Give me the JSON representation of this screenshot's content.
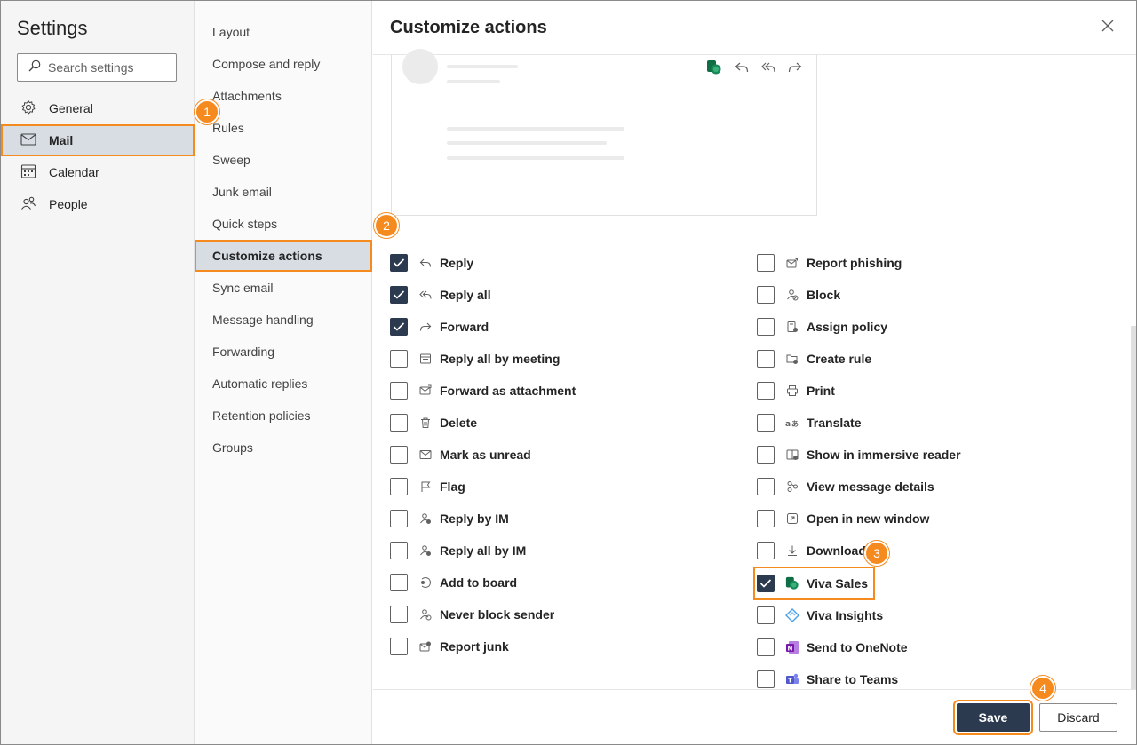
{
  "sidebar": {
    "title": "Settings",
    "search_placeholder": "Search settings",
    "items": [
      {
        "label": "General",
        "icon": "gear-icon"
      },
      {
        "label": "Mail",
        "icon": "mail-icon",
        "selected": true
      },
      {
        "label": "Calendar",
        "icon": "calendar-icon"
      },
      {
        "label": "People",
        "icon": "people-icon"
      }
    ]
  },
  "submenu": {
    "items": [
      {
        "label": "Layout"
      },
      {
        "label": "Compose and reply"
      },
      {
        "label": "Attachments"
      },
      {
        "label": "Rules"
      },
      {
        "label": "Sweep"
      },
      {
        "label": "Junk email"
      },
      {
        "label": "Quick steps"
      },
      {
        "label": "Customize actions",
        "selected": true
      },
      {
        "label": "Sync email"
      },
      {
        "label": "Message handling"
      },
      {
        "label": "Forwarding"
      },
      {
        "label": "Automatic replies"
      },
      {
        "label": "Retention policies"
      },
      {
        "label": "Groups"
      }
    ]
  },
  "main": {
    "title": "Customize actions",
    "left_actions": [
      {
        "label": "Reply",
        "checked": true,
        "icon": "reply-icon"
      },
      {
        "label": "Reply all",
        "checked": true,
        "icon": "reply-all-icon"
      },
      {
        "label": "Forward",
        "checked": true,
        "icon": "forward-icon"
      },
      {
        "label": "Reply all by meeting",
        "checked": false,
        "icon": "meeting-icon"
      },
      {
        "label": "Forward as attachment",
        "checked": false,
        "icon": "mail-attachment-icon"
      },
      {
        "label": "Delete",
        "checked": false,
        "icon": "trash-icon"
      },
      {
        "label": "Mark as unread",
        "checked": false,
        "icon": "envelope-icon"
      },
      {
        "label": "Flag",
        "checked": false,
        "icon": "flag-icon"
      },
      {
        "label": "Reply by IM",
        "checked": false,
        "icon": "person-chat-icon"
      },
      {
        "label": "Reply all by IM",
        "checked": false,
        "icon": "people-chat-icon"
      },
      {
        "label": "Add to board",
        "checked": false,
        "icon": "board-icon"
      },
      {
        "label": "Never block sender",
        "checked": false,
        "icon": "person-check-icon"
      },
      {
        "label": "Report junk",
        "checked": false,
        "icon": "junk-icon"
      }
    ],
    "right_actions": [
      {
        "label": "Report phishing",
        "checked": false,
        "icon": "phishing-icon"
      },
      {
        "label": "Block",
        "checked": false,
        "icon": "block-icon"
      },
      {
        "label": "Assign policy",
        "checked": false,
        "icon": "policy-icon"
      },
      {
        "label": "Create rule",
        "checked": false,
        "icon": "rule-icon"
      },
      {
        "label": "Print",
        "checked": false,
        "icon": "print-icon"
      },
      {
        "label": "Translate",
        "checked": false,
        "icon": "translate-icon"
      },
      {
        "label": "Show in immersive reader",
        "checked": false,
        "icon": "immersive-reader-icon"
      },
      {
        "label": "View message details",
        "checked": false,
        "icon": "details-icon"
      },
      {
        "label": "Open in new window",
        "checked": false,
        "icon": "new-window-icon"
      },
      {
        "label": "Download",
        "checked": false,
        "icon": "download-icon"
      },
      {
        "label": "Viva Sales",
        "checked": true,
        "icon": "viva-sales-icon",
        "highlighted": true
      },
      {
        "label": "Viva Insights",
        "checked": false,
        "icon": "viva-insights-icon"
      },
      {
        "label": "Send to OneNote",
        "checked": false,
        "icon": "onenote-icon"
      },
      {
        "label": "Share to Teams",
        "checked": false,
        "icon": "teams-icon"
      }
    ],
    "save_label": "Save",
    "discard_label": "Discard"
  },
  "badges": [
    "1",
    "2",
    "3",
    "4"
  ],
  "colors": {
    "accent": "#f58a1f",
    "checkbox_checked": "#2b3a4e",
    "selected_bg": "#d8dde4",
    "viva_sales": "#1a8a5a",
    "onenote": "#7719aa",
    "teams": "#5059c9"
  }
}
